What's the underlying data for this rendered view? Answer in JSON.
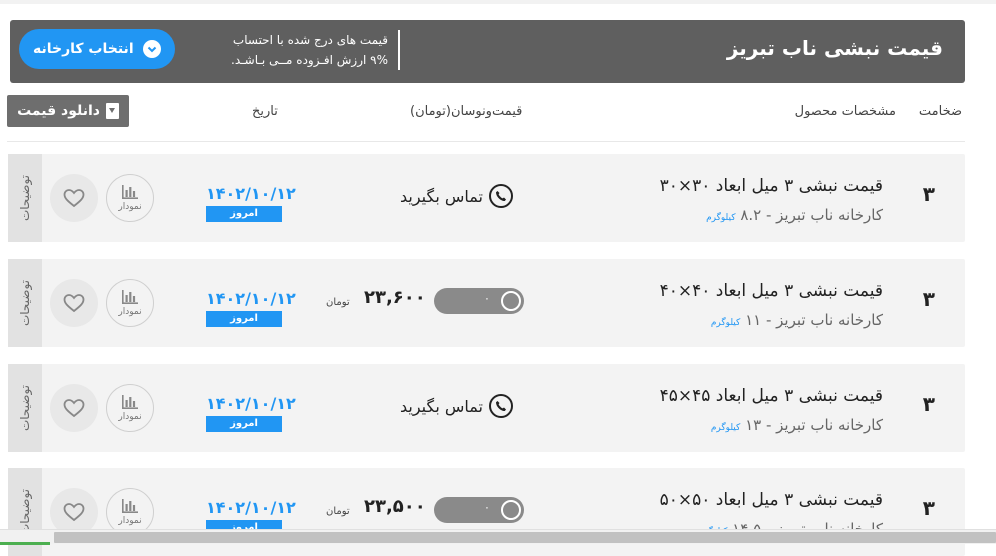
{
  "header": {
    "title": "قیمت نبشی ناب تبریز",
    "note_line1": "قیمت های درج شده با احتساب",
    "note_line2": "۹% ارزش افـزوده مــی بـاشـد.",
    "factory_button": "انتخاب کارخانه",
    "accent_color": "#2196f3"
  },
  "columns": {
    "thickness": "ضخامت",
    "spec": "مشخصات محصول",
    "price": "قیمت‌ونوسان(تومان)",
    "date": "تاریخ",
    "download": "دانلود قیمت"
  },
  "rows": [
    {
      "thickness": "۳",
      "name": "قیمت نبشی ۳ میل ابعاد ۳۰×۳۰",
      "sub": "کارخانه ناب تبریز - ",
      "weight": "۸.۲",
      "weight_unit": "کیلوگرم",
      "mode": "contact",
      "contact": "تماس بگیرید",
      "date": "۱۴۰۲/۱۰/۱۲",
      "today": "امروز",
      "chart": "نمودار",
      "desc": "توضیحات"
    },
    {
      "thickness": "۳",
      "name": "قیمت نبشی ۳ میل ابعاد ۴۰×۴۰",
      "sub": "کارخانه ناب تبریز - ",
      "weight": "۱۱",
      "weight_unit": "کیلوگرم",
      "mode": "price",
      "price": "۲۳,۶۰۰",
      "unit": "تومان",
      "change": "۰",
      "date": "۱۴۰۲/۱۰/۱۲",
      "today": "امروز",
      "chart": "نمودار",
      "desc": "توضیحات"
    },
    {
      "thickness": "۳",
      "name": "قیمت نبشی ۳ میل ابعاد ۴۵×۴۵",
      "sub": "کارخانه ناب تبریز - ",
      "weight": "۱۳",
      "weight_unit": "کیلوگرم",
      "mode": "contact",
      "contact": "تماس بگیرید",
      "date": "۱۴۰۲/۱۰/۱۲",
      "today": "امروز",
      "chart": "نمودار",
      "desc": "توضیحات"
    },
    {
      "thickness": "۳",
      "name": "قیمت نبشی ۳ میل ابعاد ۵۰×۵۰",
      "sub": "کارخانه ناب تبریز - ",
      "weight": "۱۴.۵",
      "weight_unit": "کیلوگرم",
      "mode": "price",
      "price": "۲۳,۵۰۰",
      "unit": "تومان",
      "change": "۰",
      "date": "۱۴۰۲/۱۰/۱۲",
      "today": "امروز",
      "chart": "نمودار",
      "desc": "توضیحات"
    }
  ]
}
